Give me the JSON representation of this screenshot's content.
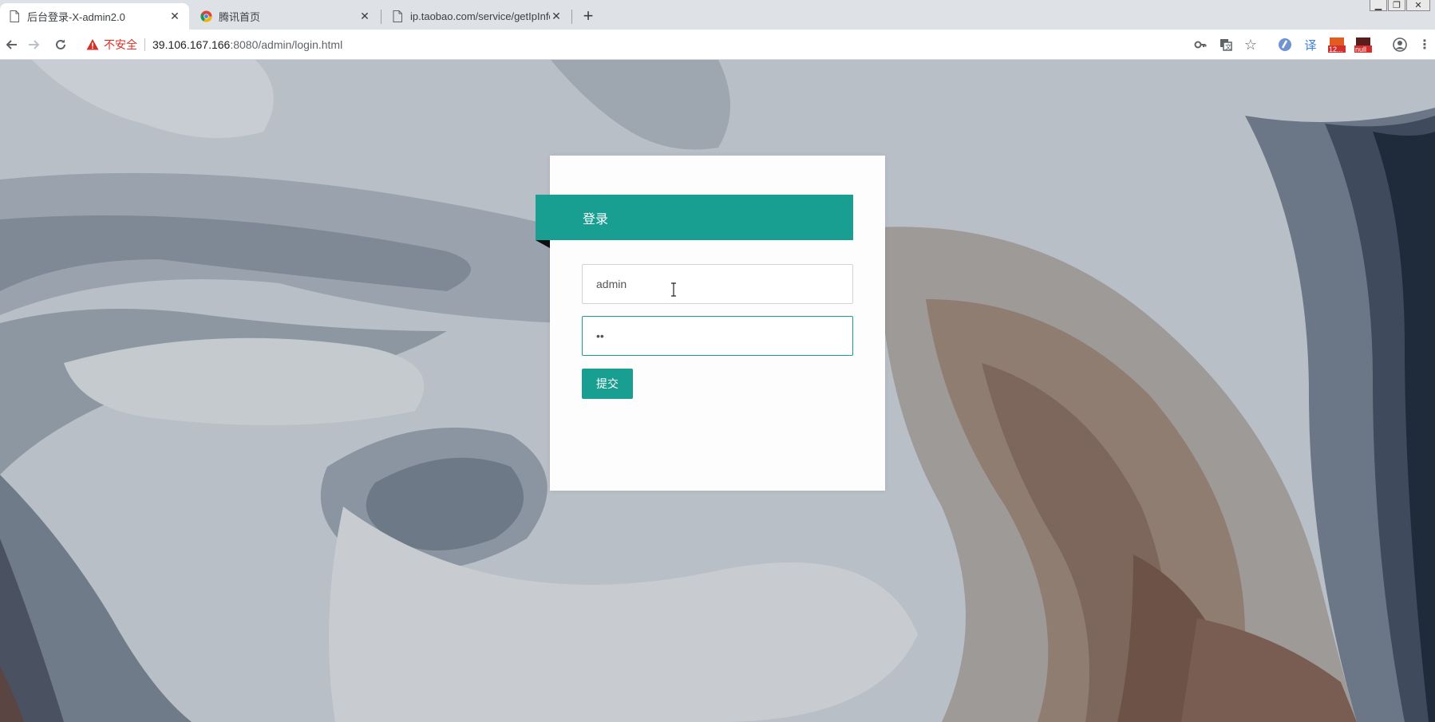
{
  "browser": {
    "tabs": [
      {
        "title": "后台登录-X-admin2.0",
        "active": true
      },
      {
        "title": "腾讯首页",
        "active": false
      },
      {
        "title": "ip.taobao.com/service/getIpInfo",
        "active": false
      }
    ],
    "security_label": "不安全",
    "url_host": "39.106.167.166",
    "url_rest": ":8080/admin/login.html",
    "extension_badges": {
      "badge1": "12...",
      "badge2": "null"
    },
    "extension_letter": "译"
  },
  "login": {
    "heading": "登录",
    "username_value": "admin",
    "password_value": "••",
    "submit_label": "提交"
  },
  "colors": {
    "accent": "#189f92",
    "insecure": "#d93025"
  }
}
